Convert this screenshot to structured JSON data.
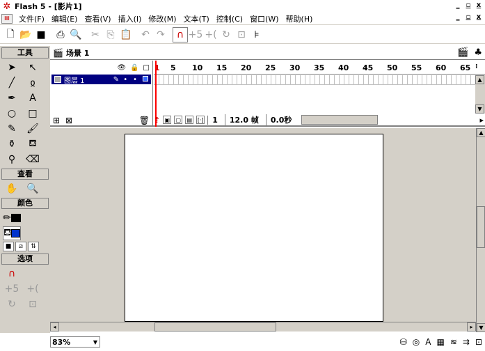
{
  "window": {
    "title": "Flash 5 - [影片1]"
  },
  "window_controls": {
    "minimize": "_",
    "restore": "▫",
    "close": "x"
  },
  "menu": {
    "items": [
      "文件(F)",
      "编辑(E)",
      "查看(V)",
      "插入(I)",
      "修改(M)",
      "文本(T)",
      "控制(C)",
      "窗口(W)",
      "帮助(H)"
    ]
  },
  "toolbar": {
    "buttons": [
      "new-icon",
      "open-icon",
      "save-icon",
      "print-icon",
      "print-preview-icon",
      "cut-icon",
      "copy-icon",
      "paste-icon",
      "undo-icon",
      "redo-icon",
      "snap-icon",
      "smooth-icon",
      "straighten-icon",
      "rotate-icon",
      "scale-icon",
      "align-icon"
    ]
  },
  "tools": {
    "header": "工具",
    "view_header": "查看",
    "colors_header": "颜色",
    "options_header": "选项",
    "stroke_color": "#000000",
    "fill_color": "#0033cc"
  },
  "scene": {
    "label": "场景 1"
  },
  "timeline": {
    "layer_name": "图层 1",
    "ticks": [
      "1",
      "5",
      "10",
      "15",
      "20",
      "25",
      "30",
      "35",
      "40",
      "45",
      "50",
      "55",
      "60",
      "65"
    ],
    "current_frame": "1",
    "frame_rate": "12.0 帧",
    "elapsed": "0.0秒"
  },
  "status": {
    "zoom": "83%"
  }
}
